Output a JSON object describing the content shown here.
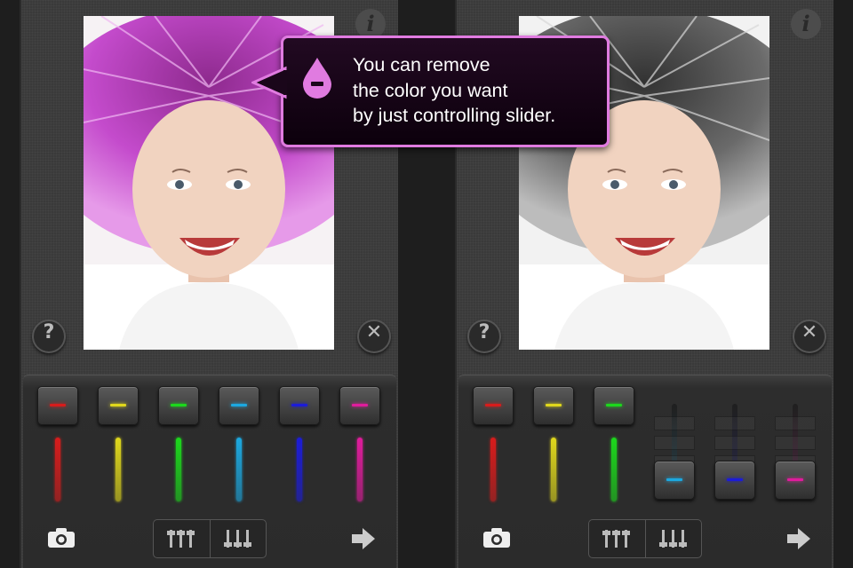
{
  "callout": {
    "lines": [
      "You can remove",
      "the color you want",
      "by just controlling slider."
    ],
    "accent": "#e07be0",
    "icon": "minus-drop-icon"
  },
  "screens": [
    {
      "photo_style": "color with magenta hair",
      "sliders": [
        {
          "color": "#d81c1c",
          "name": "red",
          "position": "top"
        },
        {
          "color": "#e0d81c",
          "name": "yellow",
          "position": "top"
        },
        {
          "color": "#1cd81c",
          "name": "green",
          "position": "top"
        },
        {
          "color": "#1ca8e0",
          "name": "cyan",
          "position": "top"
        },
        {
          "color": "#1c1cd8",
          "name": "blue",
          "position": "top"
        },
        {
          "color": "#e01c9c",
          "name": "magenta",
          "position": "top"
        }
      ]
    },
    {
      "photo_style": "grayscale with color removed",
      "sliders": [
        {
          "color": "#d81c1c",
          "name": "red",
          "position": "top"
        },
        {
          "color": "#e0d81c",
          "name": "yellow",
          "position": "top"
        },
        {
          "color": "#1cd81c",
          "name": "green",
          "position": "top"
        },
        {
          "color": "#1ca8e0",
          "name": "cyan",
          "position": "bottom"
        },
        {
          "color": "#1c1cd8",
          "name": "blue",
          "position": "bottom"
        },
        {
          "color": "#e01c9c",
          "name": "magenta",
          "position": "bottom"
        }
      ]
    }
  ],
  "icons": {
    "info": "info-icon",
    "help": "help-icon",
    "close": "close-icon",
    "camera": "camera-icon",
    "sliders_up": "sliders-up-icon",
    "sliders_down": "sliders-down-icon",
    "next": "arrow-right-icon"
  },
  "labels": {
    "info": "i",
    "help": "?",
    "close": "✕"
  }
}
